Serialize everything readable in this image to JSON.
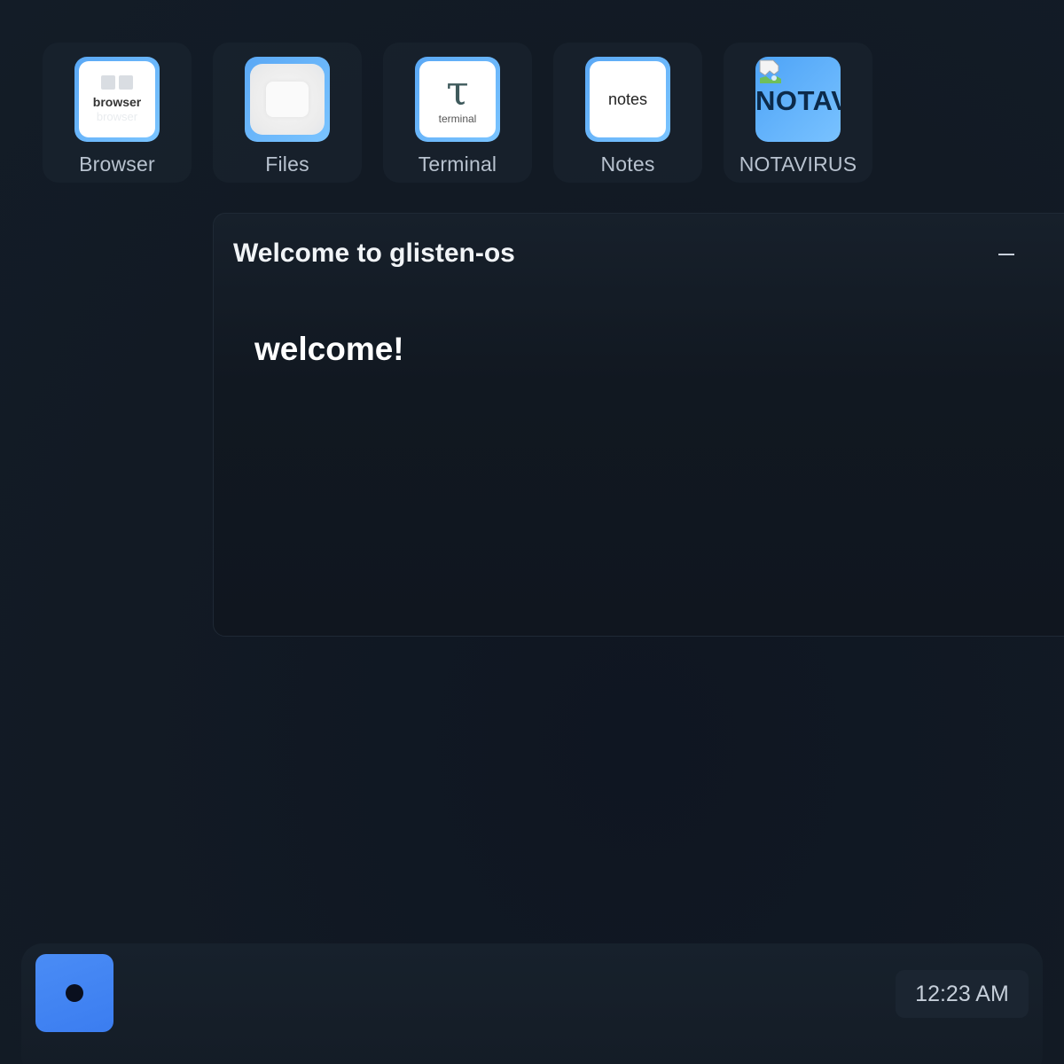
{
  "desktop": {
    "icons": [
      {
        "label": "Browser",
        "tile_text": "browser",
        "tile_subtext": "browser",
        "icon": "browser-icon"
      },
      {
        "label": "Files",
        "icon": "folder-icon"
      },
      {
        "label": "Terminal",
        "tile_glyph": "τ",
        "tile_text": "terminal",
        "icon": "terminal-icon"
      },
      {
        "label": "Notes",
        "tile_text": "notes",
        "icon": "notes-icon"
      },
      {
        "label": "NOTAVIRUS",
        "tile_text": "NOTAV",
        "icon": "broken-image-icon"
      }
    ]
  },
  "window": {
    "title": "Welcome to glisten-os",
    "body": "welcome!",
    "minimize_icon": "minimize-icon"
  },
  "taskbar": {
    "start_icon": "start-dot-icon",
    "clock": "12:23 AM"
  },
  "colors": {
    "accent": "#3b7df0",
    "tile_blue": "#5aa8f5",
    "background": "#121a24"
  }
}
